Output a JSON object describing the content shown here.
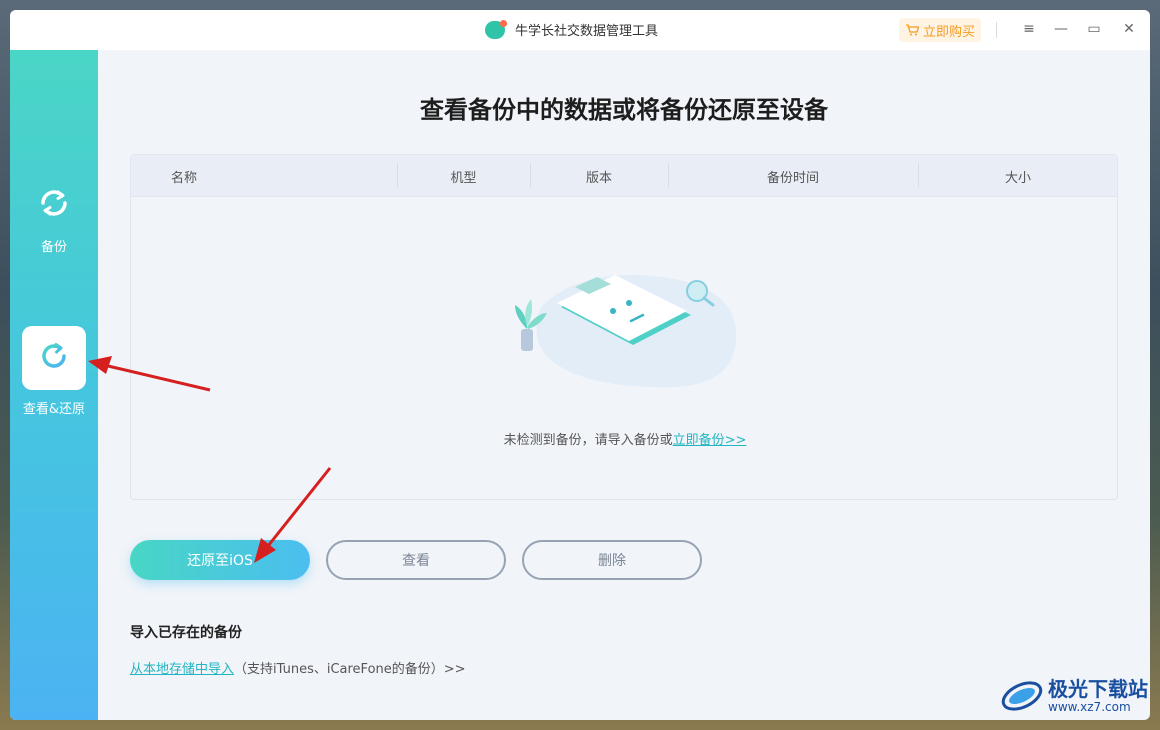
{
  "titlebar": {
    "title": "牛学长社交数据管理工具",
    "buy_label": "立即购买",
    "menu_glyph": "≡",
    "minimize_glyph": "—",
    "maximize_glyph": "▭",
    "close_glyph": "✕"
  },
  "sidebar": {
    "items": [
      {
        "label": "备份",
        "icon": "sync-icon"
      },
      {
        "label": "查看&还原",
        "icon": "restore-icon",
        "active": true
      }
    ]
  },
  "main": {
    "title": "查看备份中的数据或将备份还原至设备",
    "table": {
      "columns": [
        "名称",
        "机型",
        "版本",
        "备份时间",
        "大小"
      ],
      "rows": []
    },
    "empty": {
      "text": "未检测到备份，请导入备份或",
      "link": "立即备份>>"
    },
    "buttons": {
      "restore": "还原至iOS",
      "view": "查看",
      "delete": "删除"
    },
    "import": {
      "title": "导入已存在的备份",
      "link": "从本地存储中导入",
      "note": "（支持iTunes、iCareFone的备份）>>"
    }
  },
  "watermark": {
    "text": "极光下载站",
    "url": "www.xz7.com"
  },
  "colors": {
    "accent": "#22b5c2",
    "buy": "#f59b22",
    "sidebar_top": "#4ad6c6",
    "sidebar_bottom": "#4bb3f2",
    "annotation_arrow": "#d62020"
  }
}
